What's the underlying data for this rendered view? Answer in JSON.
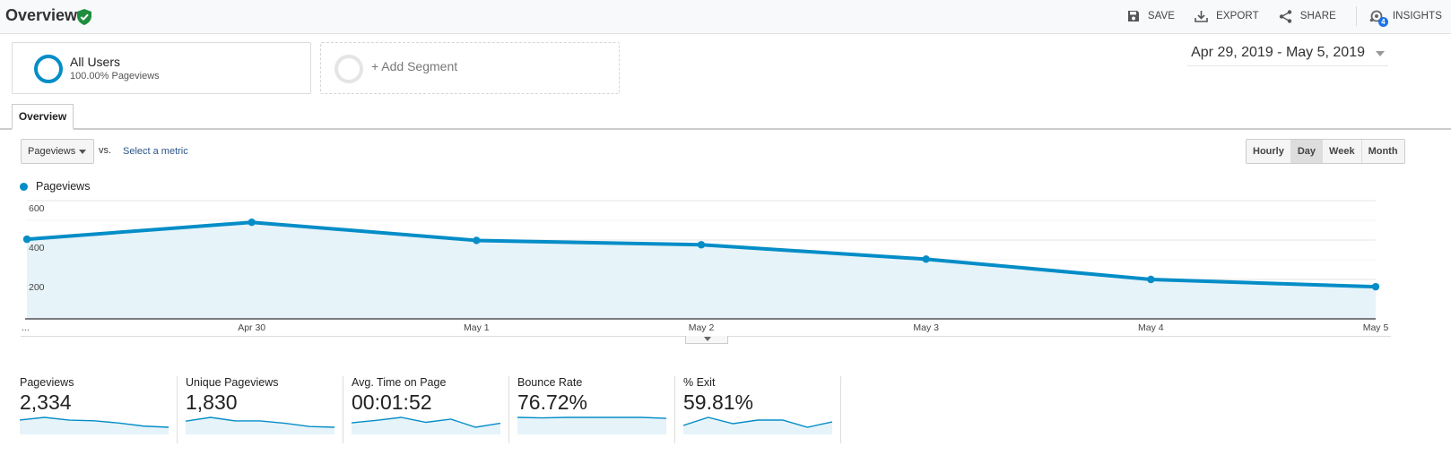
{
  "header": {
    "title": "Overview",
    "actions": [
      {
        "label": "SAVE",
        "icon": "save-icon"
      },
      {
        "label": "EXPORT",
        "icon": "export-icon"
      },
      {
        "label": "SHARE",
        "icon": "share-icon"
      },
      {
        "label": "INSIGHTS",
        "icon": "insights-icon",
        "badge": "4"
      }
    ]
  },
  "segments": {
    "all_users": {
      "name": "All Users",
      "sub": "100.00% Pageviews"
    },
    "add_segment": "+ Add Segment"
  },
  "date_range": "Apr 29, 2019 - May 5, 2019",
  "tabs": [
    {
      "label": "Overview",
      "active": true
    }
  ],
  "controls": {
    "metric_selected": "Pageviews",
    "vs_label": "vs.",
    "select_metric": "Select a metric",
    "periods": [
      {
        "label": "Hourly",
        "active": false
      },
      {
        "label": "Day",
        "active": true
      },
      {
        "label": "Week",
        "active": false
      },
      {
        "label": "Month",
        "active": false
      }
    ]
  },
  "colors": {
    "series": "#058dc7",
    "fill": "#e6f3f9",
    "verified": "#1e8e3e",
    "link": "#2c5587"
  },
  "chart_data": {
    "type": "area",
    "title": "",
    "legend": [
      {
        "name": "Pageviews",
        "position": "top-left"
      }
    ],
    "categories": [
      "Apr 29",
      "Apr 30",
      "May 1",
      "May 2",
      "May 3",
      "May 4",
      "May 5"
    ],
    "x_tick_labels": [
      "...",
      "Apr 30",
      "May 1",
      "May 2",
      "May 3",
      "May 4",
      "May 5"
    ],
    "series": [
      {
        "name": "Pageviews",
        "values": [
          404,
          490,
          398,
          376,
          303,
          200,
          163
        ]
      }
    ],
    "y_ticks": [
      200,
      400,
      600
    ],
    "ylim": [
      0,
      600
    ],
    "grid": true,
    "xlabel": "",
    "ylabel": ""
  },
  "scorecards": [
    {
      "label": "Pageviews",
      "value": "2,334",
      "spark": [
        404,
        490,
        398,
        376,
        303,
        200,
        163
      ]
    },
    {
      "label": "Unique Pageviews",
      "value": "1,830",
      "spark": [
        300,
        380,
        305,
        305,
        255,
        185,
        170
      ]
    },
    {
      "label": "Avg. Time on Page",
      "value": "00:01:52",
      "spark": [
        110,
        120,
        132,
        112,
        125,
        92,
        108
      ]
    },
    {
      "label": "Bounce Rate",
      "value": "76.72%",
      "spark": [
        80,
        79,
        80,
        80,
        80,
        80,
        78
      ]
    },
    {
      "label": "% Exit",
      "value": "59.81%",
      "spark": [
        55,
        64,
        57,
        61,
        61,
        53,
        59
      ]
    }
  ]
}
